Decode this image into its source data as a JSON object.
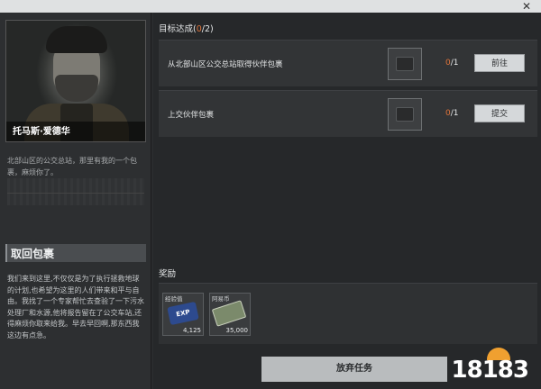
{
  "window": {
    "close_glyph": "✕"
  },
  "npc": {
    "name": "托马斯·爱德华",
    "intro": "北部山区的公交总站，那里有我的一个包裹，麻烦你了。"
  },
  "quest": {
    "title": "取回包裹",
    "description": "我们来到这里,不仅仅是为了执行拯救地球的计划,也希望为这里的人们带来和平与自由。我找了一个专家帮忙去查验了一下污水处理厂和水源,他将报告留在了公交车站,还得麻烦你取来给我。早去早回啊,那东西我这边有点急。"
  },
  "objectives": {
    "heading": "目标达成",
    "count_done": "0",
    "count_sep": "/2",
    "items": [
      {
        "label": "从北部山区公交总站取得伙伴包裹",
        "item_icon": "package-icon",
        "progress_cur": "0",
        "progress_total": "/1",
        "button": "前往"
      },
      {
        "label": "上交伙伴包裹",
        "item_icon": "package-icon",
        "progress_cur": "0",
        "progress_total": "/1",
        "button": "提交"
      }
    ]
  },
  "rewards": {
    "heading": "奖励",
    "items": [
      {
        "title": "经验值",
        "icon": "exp-card-icon",
        "icon_text": "EXP",
        "value": "4,125"
      },
      {
        "title": "阿易币",
        "icon": "money-icon",
        "value": "35,000"
      }
    ]
  },
  "footer": {
    "abandon_label": "放弃任务"
  },
  "watermark": {
    "text": "18183"
  },
  "colors": {
    "accent_orange": "#e0733a",
    "panel_dark": "#26282a",
    "button_light": "#d5d8da"
  }
}
